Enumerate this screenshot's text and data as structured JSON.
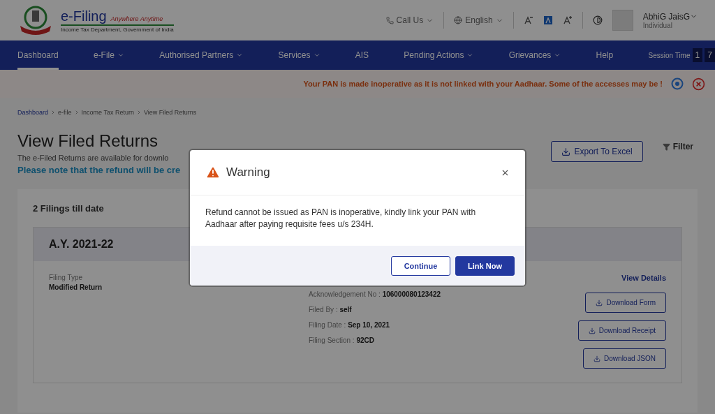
{
  "header": {
    "logo_title": "e-Filing",
    "logo_tagline": "Anywhere Anytime",
    "logo_subtitle": "Income Tax Department, Government of India",
    "call_us": "Call Us",
    "language": "English",
    "user_name": "AbhiG JaisG",
    "user_role": "Individual"
  },
  "nav": {
    "items": [
      {
        "label": "Dashboard",
        "selected": true,
        "dropdown": false
      },
      {
        "label": "e-File",
        "selected": false,
        "dropdown": true
      },
      {
        "label": "Authorised Partners",
        "selected": false,
        "dropdown": true
      },
      {
        "label": "Services",
        "selected": false,
        "dropdown": true
      },
      {
        "label": "AIS",
        "selected": false,
        "dropdown": false
      },
      {
        "label": "Pending Actions",
        "selected": false,
        "dropdown": true
      },
      {
        "label": "Grievances",
        "selected": false,
        "dropdown": true
      },
      {
        "label": "Help",
        "selected": false,
        "dropdown": false
      }
    ],
    "session_label": "Session Time",
    "session_digits": [
      "1",
      "7"
    ]
  },
  "alert": "Your PAN is made inoperative as it is not linked with your Aadhaar. Some of the accesses may be !",
  "breadcrumb": [
    "Dashboard",
    "e-file",
    "Income Tax Return",
    "View Filed Returns"
  ],
  "page": {
    "title": "View Filed Returns",
    "info": "The e-Filed Returns are available for downlo",
    "note": "Please note that the refund will be cre",
    "export_button": "Export To Excel",
    "filter": "Filter"
  },
  "filings": {
    "count": "2 Filings till date",
    "year": "A.Y. 2021-22",
    "filing_type_label": "Filing Type",
    "filing_type": "Modified Return",
    "details": [
      "Acknowledgement No : **106000080123422**",
      "Filed By : **self**",
      "Filing Date : **Sep 10, 2021**",
      "Filing Section : **92CD**"
    ],
    "view_details": "View Details",
    "downloads": [
      "Download Form",
      "Download Receipt",
      "Download JSON"
    ]
  },
  "modal": {
    "title": "Warning",
    "message": "Refund cannot be issued as PAN is inoperative, kindly link your PAN with Aadhaar after paying requisite fees u/s 234H.",
    "buttons": [
      {
        "label": "Continue",
        "kind": "secondary"
      },
      {
        "label": "Link Now",
        "kind": "primary"
      }
    ]
  }
}
